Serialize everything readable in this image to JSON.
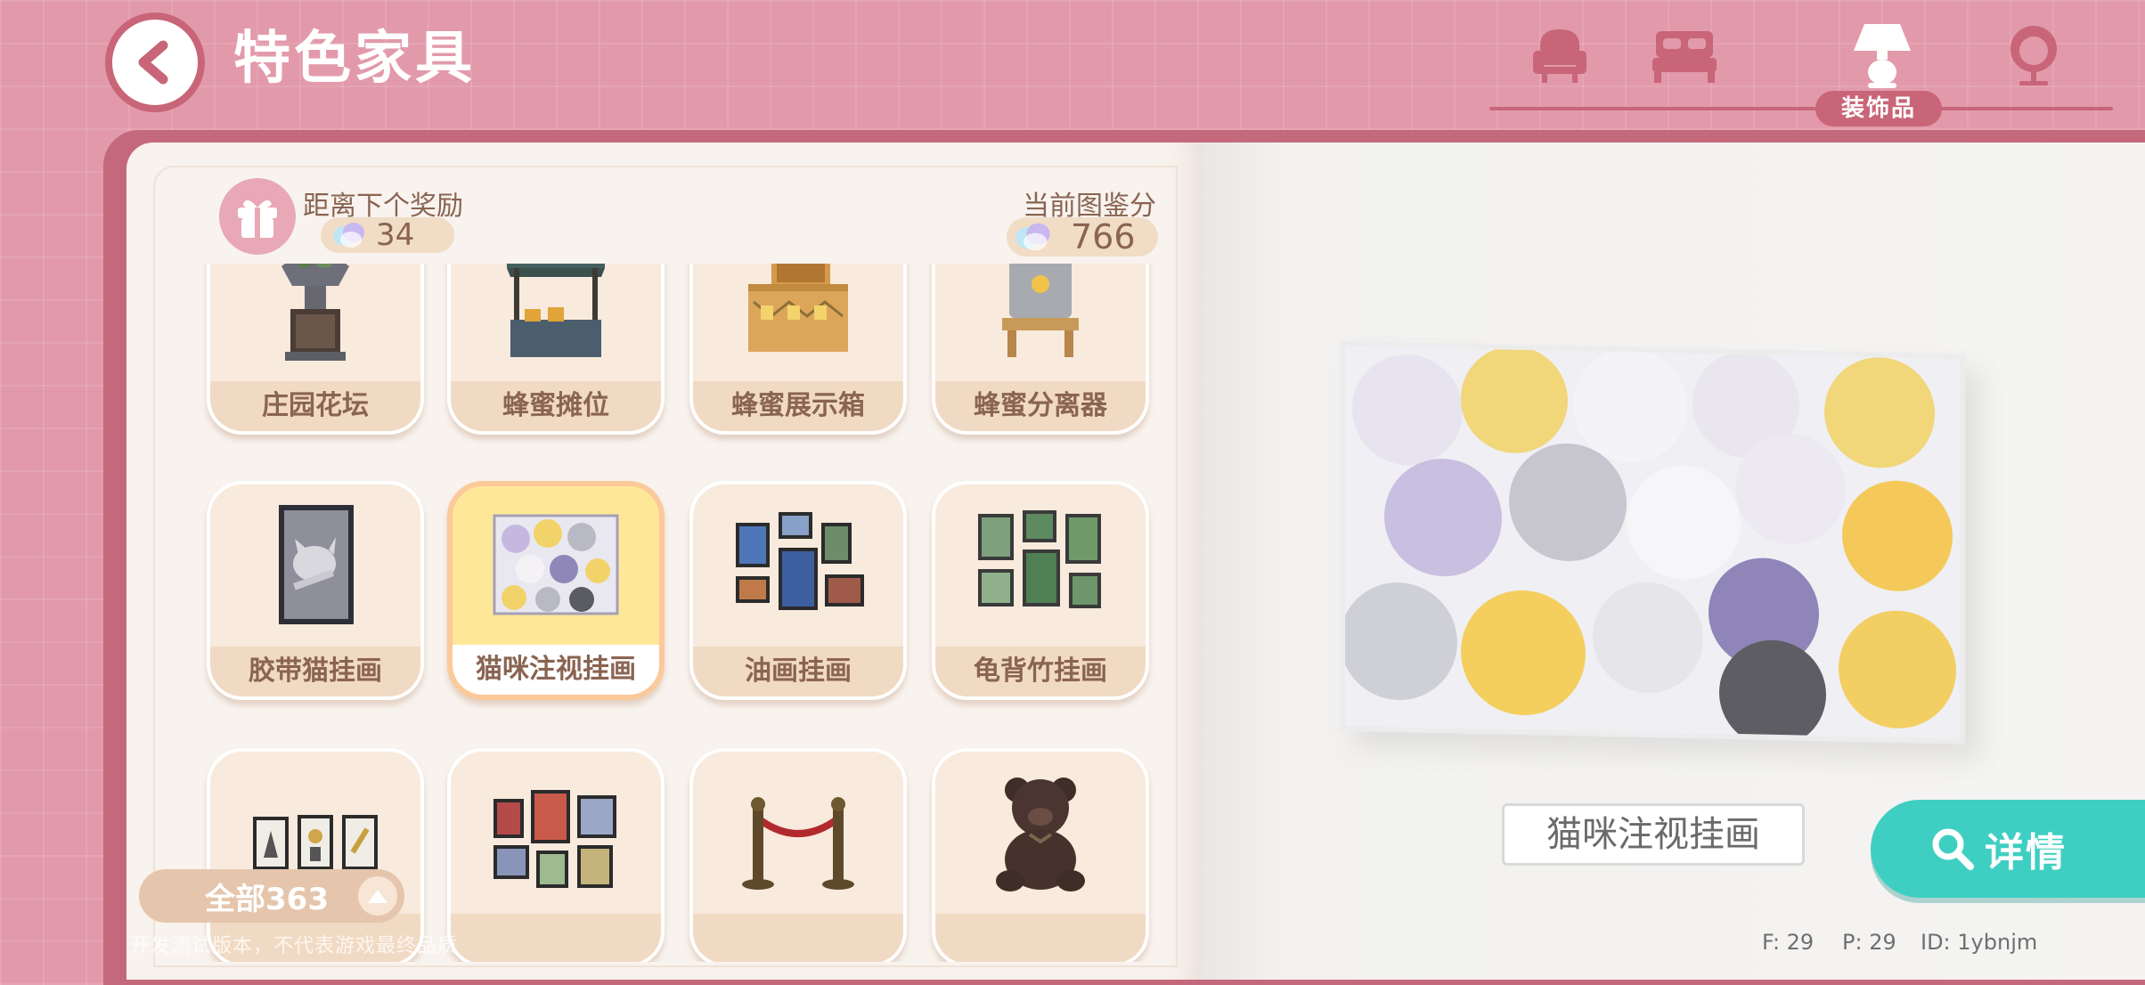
{
  "header": {
    "title": "特色家具",
    "tabs": [
      {
        "icon": "armchair-icon"
      },
      {
        "icon": "bed-icon"
      },
      {
        "icon": "lamp-icon",
        "label": "装饰品",
        "active": true
      },
      {
        "icon": "pendant-chair-icon"
      }
    ]
  },
  "reward": {
    "label": "距离下个奖励",
    "value": "34"
  },
  "score": {
    "label": "当前图鉴分",
    "value": "766"
  },
  "items": [
    {
      "label": "庄园花坛"
    },
    {
      "label": "蜂蜜摊位"
    },
    {
      "label": "蜂蜜展示箱"
    },
    {
      "label": "蜂蜜分离器"
    },
    {
      "label": "胶带猫挂画"
    },
    {
      "label": "猫咪注视挂画",
      "selected": true
    },
    {
      "label": "油画挂画"
    },
    {
      "label": "龟背竹挂画"
    },
    {
      "label": ""
    },
    {
      "label": ""
    },
    {
      "label": ""
    },
    {
      "label": ""
    }
  ],
  "filter": {
    "label": "全部363"
  },
  "watermark": "开发测试版本，不代表游戏最终品质",
  "preview": {
    "name": "猫咪注视挂画",
    "detail_label": "详情"
  },
  "debug": {
    "f": "F: 29",
    "p": "P: 29",
    "id": "ID: 1ybnjm"
  },
  "colors": {
    "accent": "#c96578",
    "teal": "#3fcfc2",
    "card": "#f8eadc",
    "selected": "#ffe79a"
  }
}
